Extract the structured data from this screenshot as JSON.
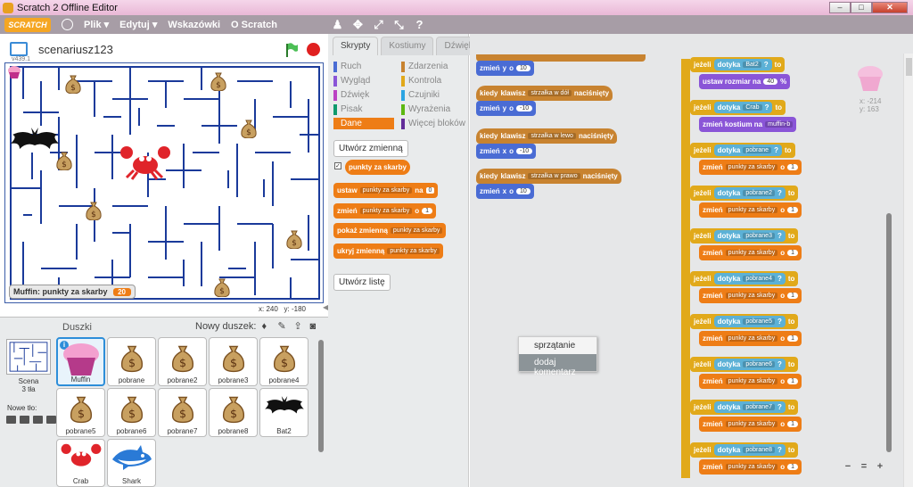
{
  "window": {
    "title": "Scratch 2 Offline Editor",
    "controls": [
      "–",
      "□",
      "✕"
    ]
  },
  "menu": {
    "logo": "SCRATCH",
    "items": [
      "Plik ▾",
      "Edytuj ▾",
      "Wskazówki",
      "O Scratch"
    ]
  },
  "stage": {
    "version": "v439.1",
    "project_name": "scenariusz123",
    "monitor_label": "Muffin: punkty za skarby",
    "monitor_value": "20",
    "coords_x_label": "x:",
    "coords_x": "240",
    "coords_y_label": "y:",
    "coords_y": "-180"
  },
  "sprites": {
    "header": "Duszki",
    "new_sprite": "Nowy duszek:",
    "scene_label": "Scena",
    "scene_sub": "3 tła",
    "new_bg": "Nowe tło:",
    "items": [
      {
        "name": "Muffin"
      },
      {
        "name": "pobrane"
      },
      {
        "name": "pobrane2"
      },
      {
        "name": "pobrane3"
      },
      {
        "name": "pobrane4"
      },
      {
        "name": "pobrane5"
      },
      {
        "name": "pobrane6"
      },
      {
        "name": "pobrane7"
      },
      {
        "name": "pobrane8"
      },
      {
        "name": "Bat2"
      },
      {
        "name": "Crab"
      },
      {
        "name": "Shark"
      }
    ]
  },
  "tabs": [
    "Skrypty",
    "Kostiumy",
    "Dźwięki"
  ],
  "categories": [
    {
      "label": "Ruch",
      "color": "#4a6cd4"
    },
    {
      "label": "Zdarzenia",
      "color": "#c88330"
    },
    {
      "label": "Wygląd",
      "color": "#8a55d7"
    },
    {
      "label": "Kontrola",
      "color": "#e1a91a"
    },
    {
      "label": "Dźwięk",
      "color": "#bb42c3"
    },
    {
      "label": "Czujniki",
      "color": "#2ca5e2"
    },
    {
      "label": "Pisak",
      "color": "#0e9a6c"
    },
    {
      "label": "Wyrażenia",
      "color": "#5cb712"
    },
    {
      "label": "Dane",
      "color": "#ee7d16"
    },
    {
      "label": "Więcej bloków",
      "color": "#632d99"
    }
  ],
  "palette": {
    "make_var": "Utwórz zmienną",
    "var_name": "punkty za skarby",
    "set": "ustaw",
    "set_val": "0",
    "change": "zmień",
    "change_val": "1",
    "show": "pokaż zmienną",
    "hide": "ukryj zmienną",
    "make_list": "Utwórz listę",
    "to": "na",
    "by": "o"
  },
  "scripts": {
    "left": [
      {
        "kind": "motion",
        "parts": [
          "zmień",
          "y",
          "o"
        ],
        "val": "10"
      },
      {
        "kind": "event",
        "parts": [
          "kiedy",
          "klawisz"
        ],
        "drop": "strzałka w dół",
        "tail": "naciśnięty"
      },
      {
        "kind": "motion",
        "parts": [
          "zmień",
          "y",
          "o"
        ],
        "val": "-10"
      },
      {
        "kind": "event",
        "parts": [
          "kiedy",
          "klawisz"
        ],
        "drop": "strzałka w lewo",
        "tail": "naciśnięty"
      },
      {
        "kind": "motion",
        "parts": [
          "zmień",
          "x",
          "o"
        ],
        "val": "-10"
      },
      {
        "kind": "event",
        "parts": [
          "kiedy",
          "klawisz"
        ],
        "drop": "strzałka w prawo",
        "tail": "naciśnięty"
      },
      {
        "kind": "motion",
        "parts": [
          "zmień",
          "x",
          "o"
        ],
        "val": "10"
      }
    ],
    "if_word": "jeżeli",
    "touch_word": "dotyka",
    "then_word": "to",
    "size_line": {
      "text": "ustaw rozmiar na",
      "val": "40",
      "unit": "%"
    },
    "costume_line": {
      "text": "zmień kostium na",
      "drop": "muffin-b"
    },
    "change_word": "zmień",
    "by_word": "o",
    "var_drop": "punkty za skarby",
    "inc": "1",
    "right_targets": [
      "Bat2",
      "Crab",
      "pobrane",
      "pobrane2",
      "pobrane3",
      "pobrane4",
      "pobrane5",
      "pobrane6",
      "pobrane7",
      "pobrane8"
    ],
    "q": "?"
  },
  "context_menu": {
    "item1": "sprzątanie",
    "item2": "dodaj komentarz"
  },
  "sprite_coords": {
    "x": "x: -214",
    "y": "y: 163"
  },
  "zoom": [
    "−",
    "=",
    "+"
  ]
}
